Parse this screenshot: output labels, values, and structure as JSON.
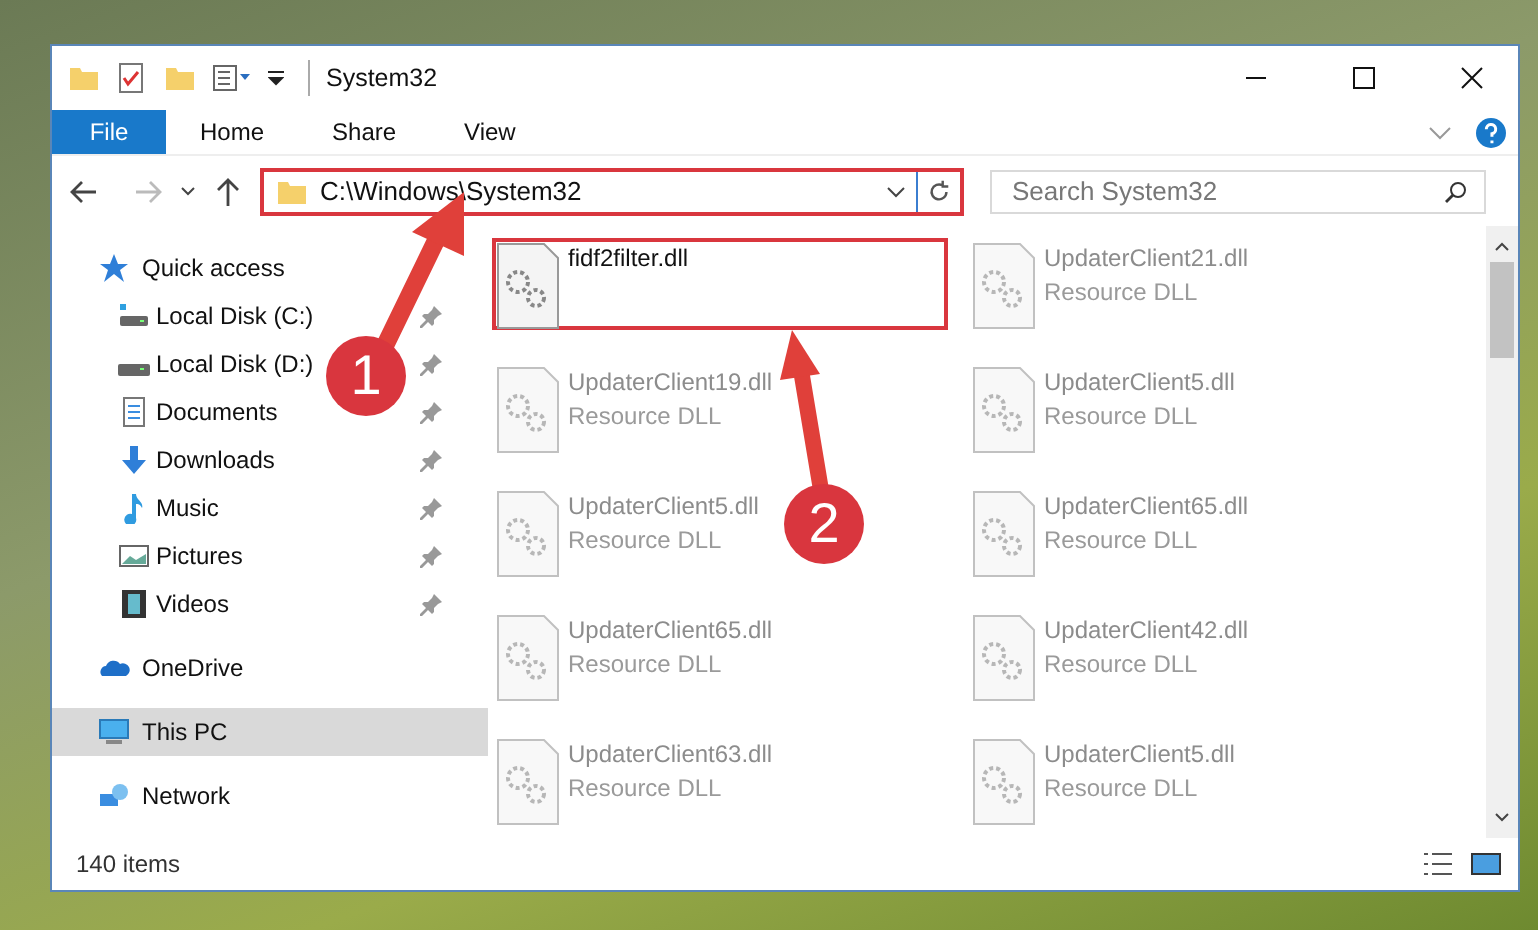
{
  "window": {
    "title": "System32"
  },
  "ribbon_tabs": [
    {
      "label": "File",
      "selected": true
    },
    {
      "label": "Home",
      "selected": false
    },
    {
      "label": "Share",
      "selected": false
    },
    {
      "label": "View",
      "selected": false
    }
  ],
  "address": {
    "path": "C:\\Windows\\System32"
  },
  "search": {
    "placeholder": "Search System32"
  },
  "sidebar": {
    "items": [
      {
        "label": "Quick access",
        "selected": false,
        "children": [
          {
            "label": "Local Disk (C:)",
            "pinned": true
          },
          {
            "label": "Local Disk (D:)",
            "pinned": true
          },
          {
            "label": "Documents",
            "pinned": true
          },
          {
            "label": "Downloads",
            "pinned": true
          },
          {
            "label": "Music",
            "pinned": true
          },
          {
            "label": "Pictures",
            "pinned": true
          },
          {
            "label": "Videos",
            "pinned": true
          }
        ]
      },
      {
        "label": "OneDrive",
        "selected": false
      },
      {
        "label": "This PC",
        "selected": true
      },
      {
        "label": "Network",
        "selected": false
      }
    ]
  },
  "files": [
    {
      "name": "fidf2filter.dll",
      "dimmed": false
    },
    {
      "name": "UpdaterClient21.dll",
      "type": "Resource DLL",
      "dimmed": true
    },
    {
      "name": "UpdaterClient19.dll",
      "type": "Resource DLL",
      "dimmed": true
    },
    {
      "name": "UpdaterClient5.dll",
      "type": "Resource DLL",
      "dimmed": true
    },
    {
      "name": "UpdaterClient5.dll",
      "type": "Resource DLL",
      "dimmed": true
    },
    {
      "name": "UpdaterClient65.dll",
      "type": "Resource DLL",
      "dimmed": true
    },
    {
      "name": "UpdaterClient65.dll",
      "type": "Resource DLL",
      "dimmed": true
    },
    {
      "name": "UpdaterClient42.dll",
      "type": "Resource DLL",
      "dimmed": true
    },
    {
      "name": "UpdaterClient63.dll",
      "type": "Resource DLL",
      "dimmed": true
    },
    {
      "name": "UpdaterClient5.dll",
      "type": "Resource DLL",
      "dimmed": true
    }
  ],
  "status_bar": {
    "count": "140 items"
  },
  "annotations": [
    {
      "label": "1"
    },
    {
      "label": "2"
    }
  ]
}
